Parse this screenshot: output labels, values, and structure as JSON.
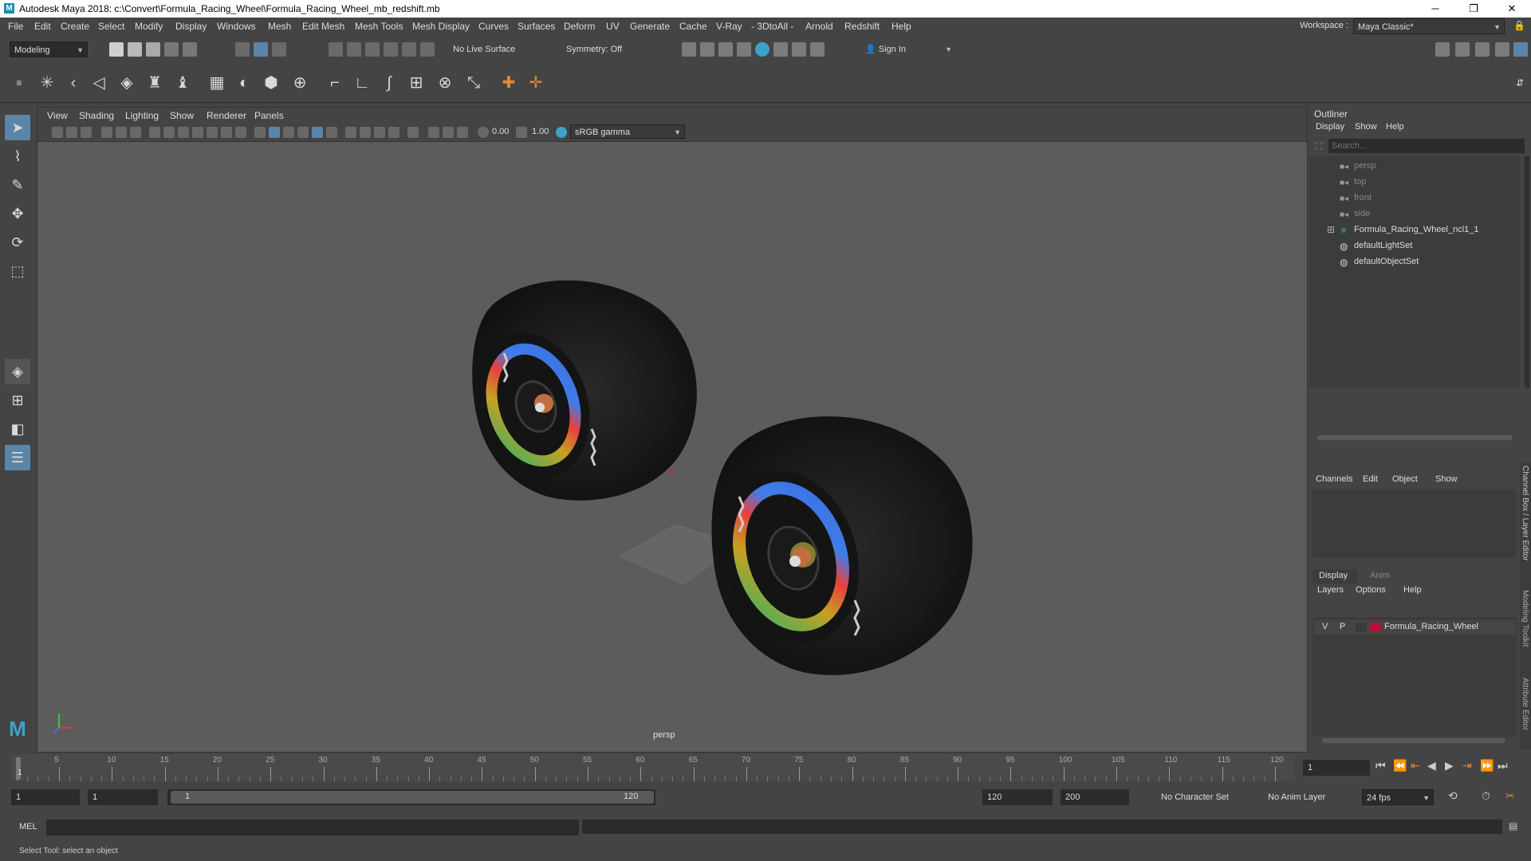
{
  "window": {
    "title": "Autodesk Maya 2018: c:\\Convert\\Formula_Racing_Wheel\\Formula_Racing_Wheel_mb_redshift.mb",
    "logo": "M",
    "minimize": "─",
    "maximize": "❐",
    "close": "✕"
  },
  "menubar": {
    "items": [
      "File",
      "Edit",
      "Create",
      "Select",
      "Modify",
      "Display",
      "Windows",
      "Mesh",
      "Edit Mesh",
      "Mesh Tools",
      "Mesh Display",
      "Curves",
      "Surfaces",
      "Deform",
      "UV",
      "Generate",
      "Cache",
      "V-Ray",
      "- 3DtoAll -",
      "Arnold",
      "Redshift",
      "Help"
    ],
    "workspace_label": "Workspace :",
    "workspace_value": "Maya Classic*"
  },
  "statusline": {
    "mode": "Modeling",
    "live_surface": "No Live Surface",
    "symmetry": "Symmetry: Off",
    "sign_in": "Sign In"
  },
  "viewport": {
    "menus": [
      "View",
      "Shading",
      "Lighting",
      "Show",
      "Renderer",
      "Panels"
    ],
    "exposure": "0.00",
    "gamma": "1.00",
    "colorspace": "sRGB gamma",
    "camera_label": "persp"
  },
  "outliner": {
    "title": "Outliner",
    "menus": [
      "Display",
      "Show",
      "Help"
    ],
    "search_placeholder": "Search...",
    "items": [
      {
        "label": "persp",
        "kind": "camera"
      },
      {
        "label": "top",
        "kind": "camera"
      },
      {
        "label": "front",
        "kind": "camera"
      },
      {
        "label": "side",
        "kind": "camera"
      },
      {
        "label": "Formula_Racing_Wheel_ncl1_1",
        "kind": "group"
      },
      {
        "label": "defaultLightSet",
        "kind": "set"
      },
      {
        "label": "defaultObjectSet",
        "kind": "set"
      }
    ],
    "expand": "⊞"
  },
  "channelbox": {
    "menus": [
      "Channels",
      "Edit",
      "Object",
      "Show"
    ]
  },
  "layers": {
    "tabs": [
      "Display",
      "Anim"
    ],
    "menus": [
      "Layers",
      "Options",
      "Help"
    ],
    "layer": {
      "v": "V",
      "p": "P",
      "name": "Formula_Racing_Wheel",
      "color": "#b0123a"
    }
  },
  "side_tabs": [
    "Channel Box / Layer Editor",
    "Modeling Toolkit",
    "Attribute Editor"
  ],
  "timeline": {
    "ticks": [
      "5",
      "10",
      "15",
      "20",
      "25",
      "30",
      "35",
      "40",
      "45",
      "50",
      "55",
      "60",
      "65",
      "70",
      "75",
      "80",
      "85",
      "90",
      "95",
      "100",
      "105",
      "110",
      "115",
      "120"
    ],
    "start_marker": "1",
    "current_frame": "1"
  },
  "range": {
    "start": "1",
    "playback_start": "1",
    "slider_start": "1",
    "slider_end": "120",
    "playback_end": "120",
    "end": "200",
    "character_set": "No Character Set",
    "anim_layer": "No Anim Layer",
    "fps": "24 fps"
  },
  "cmdline": {
    "label": "MEL"
  },
  "helpline": {
    "text": "Select Tool: select an object"
  }
}
